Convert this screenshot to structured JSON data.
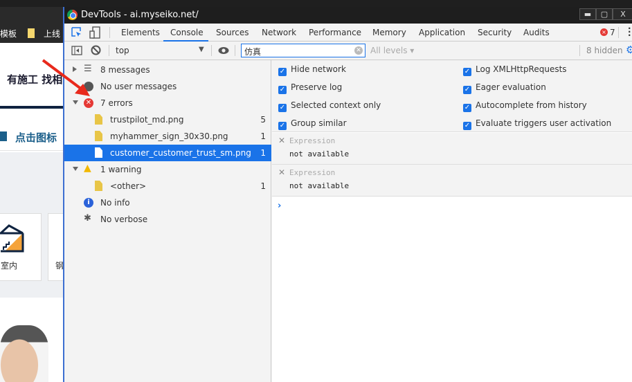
{
  "background_page": {
    "bookmarks": [
      "模板",
      "上线"
    ],
    "headline": "有施工 找相",
    "section_label": "点击图标",
    "cards": [
      "室内",
      "钢"
    ]
  },
  "devtools": {
    "title": "DevTools - ai.myseiko.net/",
    "window_buttons": {
      "minimize": "▬",
      "maximize": "▢",
      "close": "X"
    },
    "tabs": [
      "Elements",
      "Console",
      "Sources",
      "Network",
      "Performance",
      "Memory",
      "Application",
      "Security",
      "Audits"
    ],
    "active_tab": "Console",
    "error_count": "7",
    "toolbar": {
      "context": "top",
      "filter_value": "仿真",
      "levels": "All levels ▾",
      "hidden": "8 hidden"
    },
    "sidebar": {
      "messages": "8 messages",
      "user": "No user messages",
      "errors": "7 errors",
      "error_files": [
        {
          "name": "trustpilot_md.png",
          "count": "5"
        },
        {
          "name": "myhammer_sign_30x30.png",
          "count": "1"
        },
        {
          "name": "customer_customer_trust_sm.png",
          "count": "1",
          "selected": true
        }
      ],
      "warnings": "1 warning",
      "warning_files": [
        {
          "name": "<other>",
          "count": "1"
        }
      ],
      "info": "No info",
      "verbose": "No verbose"
    },
    "settings": {
      "left": [
        "Hide network",
        "Preserve log",
        "Selected context only",
        "Group similar"
      ],
      "right": [
        "Log XMLHttpRequests",
        "Eager evaluation",
        "Autocomplete from history",
        "Evaluate triggers user activation"
      ]
    },
    "expressions": [
      {
        "label": "Expression",
        "value": "not available"
      },
      {
        "label": "Expression",
        "value": "not available"
      }
    ],
    "prompt": "›",
    "accent_color": "#1a73e8"
  }
}
